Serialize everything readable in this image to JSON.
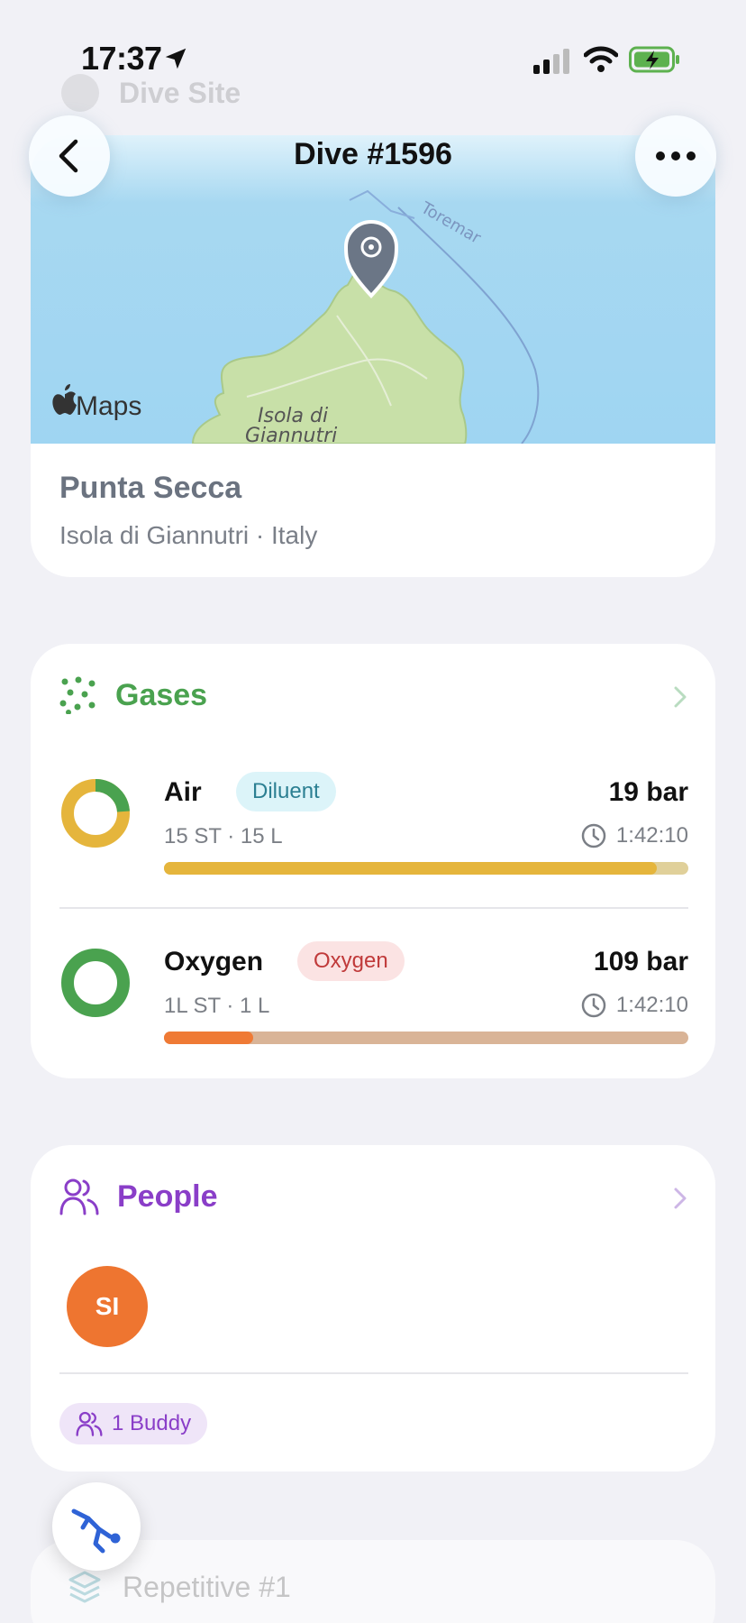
{
  "status": {
    "time": "17:37"
  },
  "header": {
    "title": "Dive #1596",
    "faded_label": "Dive Site"
  },
  "site": {
    "name": "Punta Secca",
    "subtitle": "Isola di Giannutri · Italy",
    "map_label_island": "Isola di Giannutri",
    "map_label_island_line1": "Isola di",
    "map_label_island_line2": "Giannutri",
    "map_label_route": "Toremar",
    "map_attribution": "Maps"
  },
  "gases": {
    "title": "Gases",
    "accent": "#4aa24f",
    "items": [
      {
        "name": "Air",
        "badge": "Diluent",
        "badge_bg": "#dcf4f9",
        "badge_color": "#2b7f92",
        "pressure": "19 bar",
        "tank": "15 ST · 15 L",
        "time": "1:42:10",
        "fill_fraction": 0.94,
        "bar_color": "#e5b53c",
        "track_color": "#e0d09a"
      },
      {
        "name": "Oxygen",
        "badge": "Oxygen",
        "badge_bg": "#fbe3e3",
        "badge_color": "#c03a3a",
        "pressure": "109 bar",
        "tank": "1L ST · 1 L",
        "time": "1:42:10",
        "fill_fraction": 0.17,
        "bar_color": "#ef7a35",
        "track_color": "#d9b497"
      }
    ]
  },
  "people": {
    "title": "People",
    "accent": "#8a3ec8",
    "avatar_initials": "SI",
    "buddy_label": "1 Buddy"
  },
  "next": {
    "label": "Repetitive #1"
  }
}
